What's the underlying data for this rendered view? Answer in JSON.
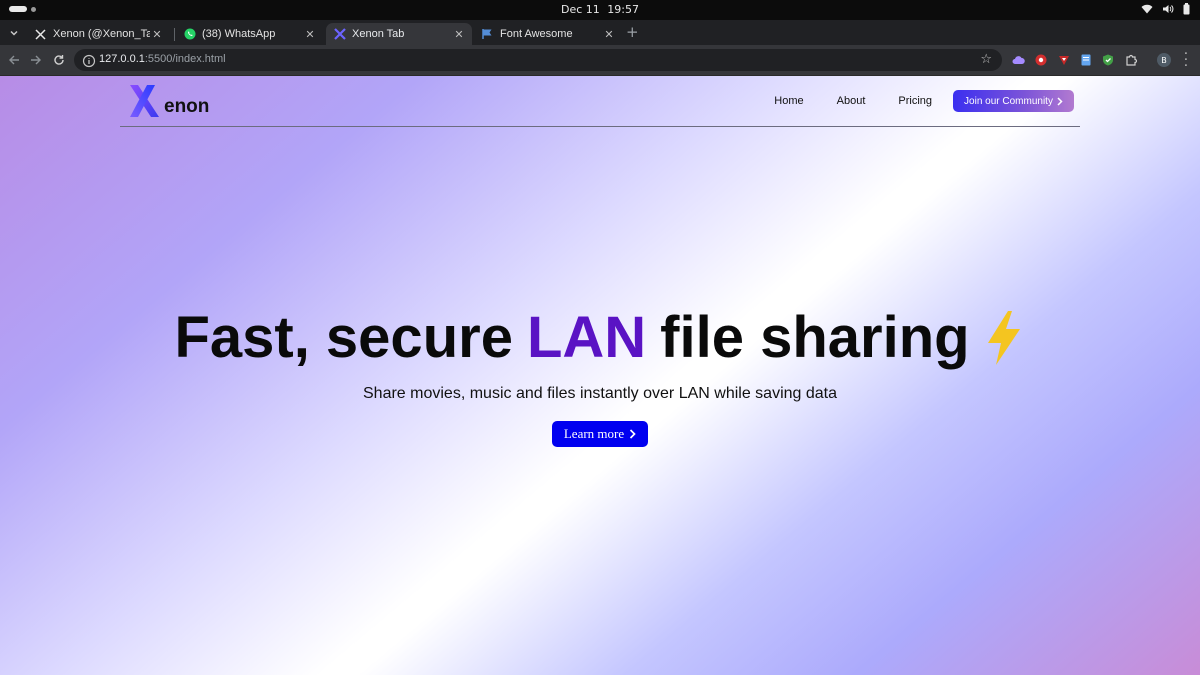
{
  "os": {
    "date": "Dec 11",
    "time": "19:57"
  },
  "browser": {
    "tabs": [
      {
        "title": "Xenon (@Xenon_Tab) / X",
        "favicon": "x-logo-icon"
      },
      {
        "title": "(38) WhatsApp",
        "favicon": "whatsapp-icon"
      },
      {
        "title": "Xenon Tab",
        "favicon": "xenon-logo-icon",
        "active": true
      },
      {
        "title": "Font Awesome",
        "favicon": "flag-icon"
      }
    ],
    "url_host": "127.0.0.1",
    "url_rest": ":5500/index.html",
    "profile_initial": "B"
  },
  "page": {
    "logo_text": "enon",
    "nav": {
      "home": "Home",
      "about": "About",
      "pricing": "Pricing",
      "cta": "Join our Community"
    },
    "hero": {
      "headline_before": "Fast, secure",
      "headline_accent": "LAN",
      "headline_after": "file sharing",
      "subtitle": "Share movies, music and files instantly over LAN while saving data",
      "button": "Learn more"
    },
    "colors": {
      "accent": "#5a13c4",
      "primary_button": "#0000f0",
      "cta_start": "#3b2ff0",
      "cta_end": "#b27ad0"
    }
  }
}
